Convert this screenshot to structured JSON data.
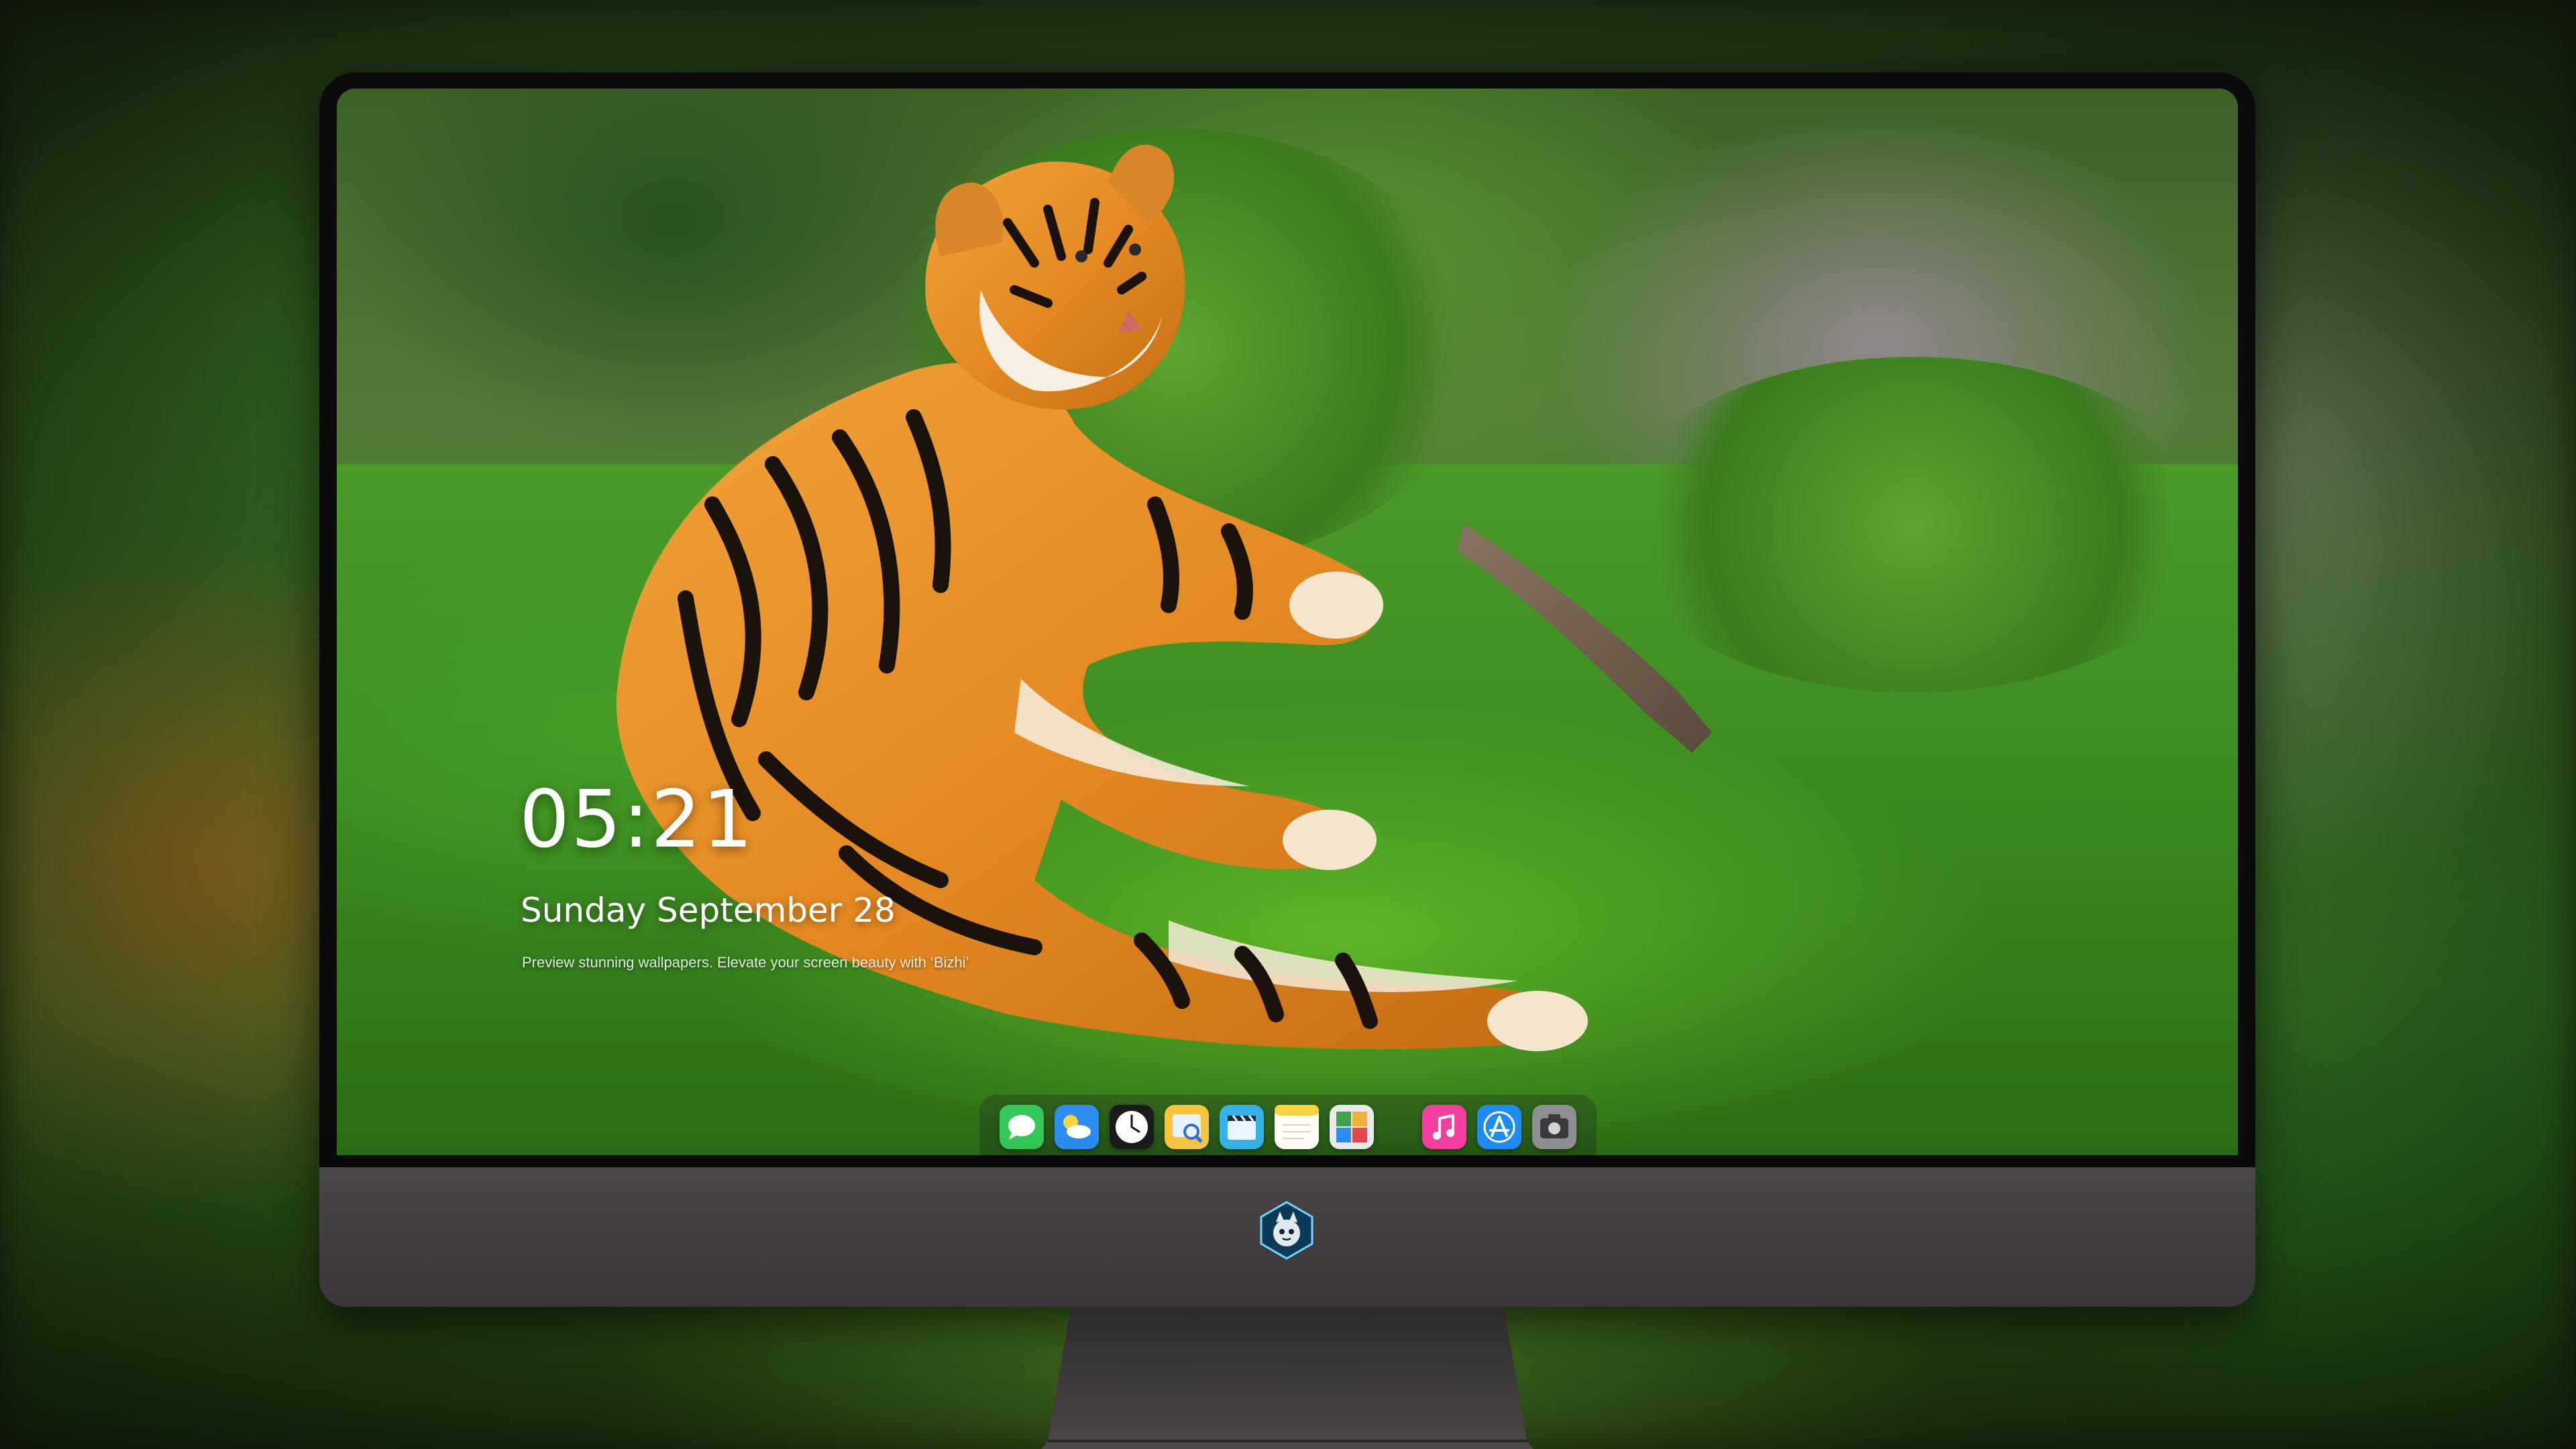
{
  "lock_screen": {
    "time": "05:21",
    "date": "Sunday September  28",
    "tagline": "Preview stunning wallpapers. Elevate your screen beauty with ‘Bizhi’"
  },
  "wallpaper": {
    "subject": "tiger lying on grass"
  },
  "dock": {
    "items": [
      {
        "icon": "messages-icon",
        "color": "#34c759"
      },
      {
        "icon": "weather-icon",
        "color": "#2f8cf0"
      },
      {
        "icon": "clock-icon",
        "color": "#ffffff"
      },
      {
        "icon": "preview-icon",
        "color": "#f5c542"
      },
      {
        "icon": "clips-icon",
        "color": "#36b3e6"
      },
      {
        "icon": "notes-icon",
        "color": "#ffd23f"
      },
      {
        "icon": "photo-booth-icon",
        "color": "#3fa34d"
      },
      {
        "icon": "music-icon",
        "color": "#f53fa0"
      },
      {
        "icon": "app-store-icon",
        "color": "#1f8cf5"
      },
      {
        "icon": "screenshot-icon",
        "color": "#8e8e93"
      }
    ]
  },
  "colors": {
    "bezel": "#0b0b0d",
    "chin": "#423e41",
    "stand": "#3d3a3c"
  }
}
